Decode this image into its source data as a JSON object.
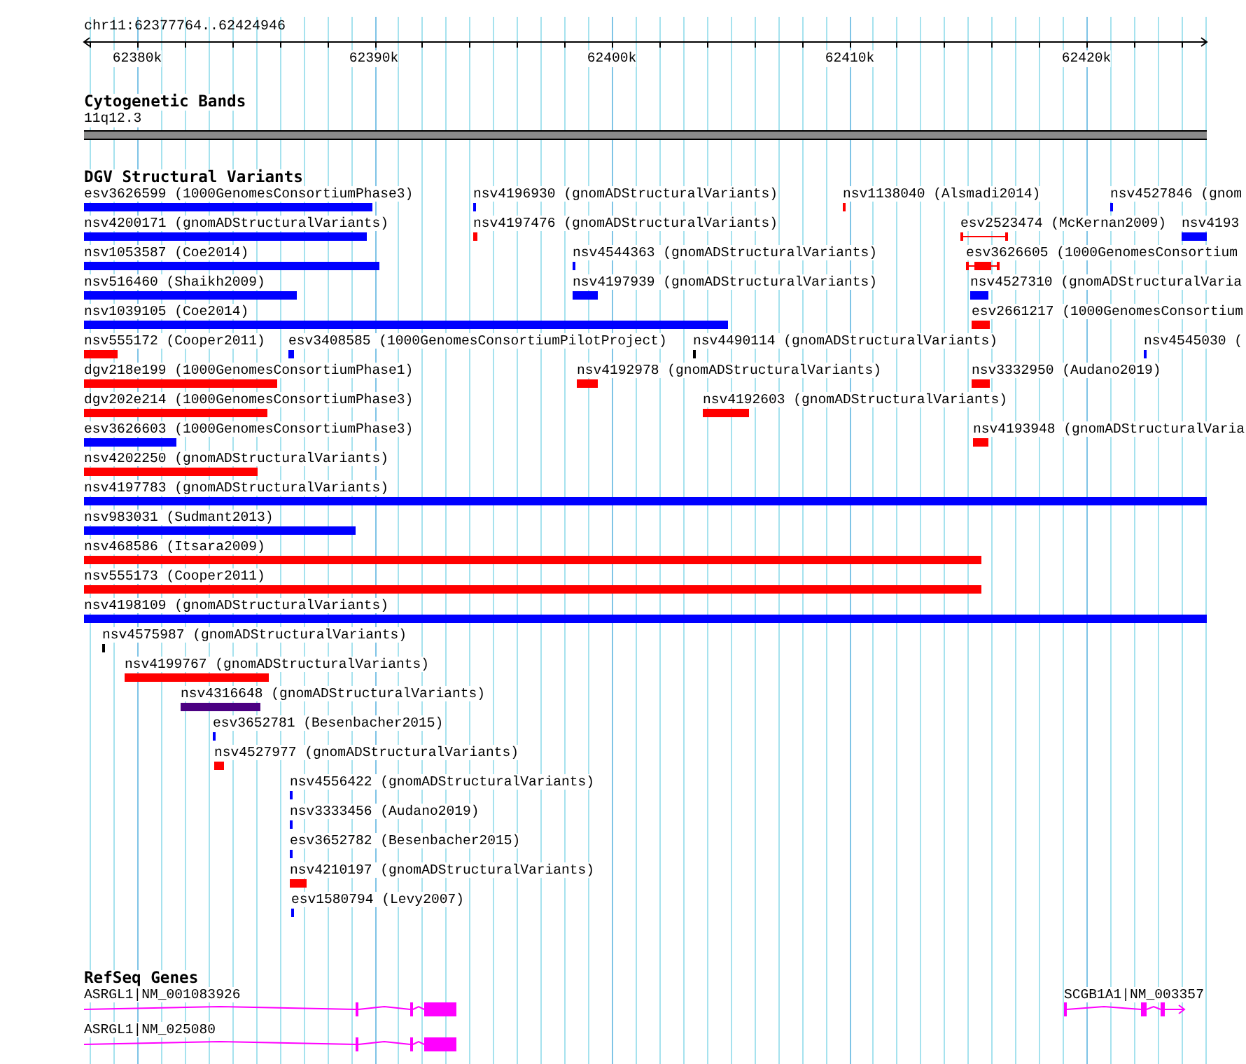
{
  "position": "chr11:62377764..62424946",
  "ruler": {
    "ticks": [
      {
        "label": "62380k"
      },
      {
        "label": "62390k"
      },
      {
        "label": "62400k"
      },
      {
        "label": "62410k"
      },
      {
        "label": "62420k"
      }
    ]
  },
  "cytoband": {
    "title": "Cytogenetic Bands",
    "band": "11q12.3"
  },
  "variants": {
    "title": "DGV Structural Variants",
    "rows": [
      {
        "features": [
          {
            "kind": "bar",
            "label": "esv3626599 (1000GenomesConsortiumPhase3)",
            "color": "#0000ff"
          },
          {
            "kind": "bar",
            "label": "nsv4196930 (gnomADStructuralVariants)",
            "color": "#0000ff"
          },
          {
            "kind": "bar",
            "label": "nsv1138040 (Alsmadi2014)",
            "color": "#ff0000"
          },
          {
            "kind": "bar",
            "label": "nsv4527846 (gnom",
            "color": "#0000ff"
          }
        ]
      },
      {
        "features": [
          {
            "kind": "bar",
            "label": "nsv4200171 (gnomADStructuralVariants)",
            "color": "#0000ff"
          },
          {
            "kind": "bar",
            "label": "nsv4197476 (gnomADStructuralVariants)",
            "color": "#ff0000"
          },
          {
            "kind": "interval",
            "label": "esv2523474 (McKernan2009)",
            "color": "#ff0000"
          },
          {
            "kind": "bar",
            "label": "nsv4193",
            "color": "#0000ff"
          }
        ]
      },
      {
        "features": [
          {
            "kind": "bar",
            "label": "nsv1053587 (Coe2014)",
            "color": "#0000ff"
          },
          {
            "kind": "bar",
            "label": "nsv4544363 (gnomADStructuralVariants)",
            "color": "#0000ff"
          },
          {
            "kind": "interval_bar",
            "label": "esv3626605 (1000GenomesConsortium",
            "color": "#ff0000"
          }
        ]
      },
      {
        "features": [
          {
            "kind": "bar",
            "label": "nsv516460 (Shaikh2009)",
            "color": "#0000ff"
          },
          {
            "kind": "bar",
            "label": "nsv4197939 (gnomADStructuralVariants)",
            "color": "#0000ff"
          },
          {
            "kind": "bar",
            "label": "nsv4527310 (gnomADStructuralVaria",
            "color": "#0000ff"
          }
        ]
      },
      {
        "features": [
          {
            "kind": "bar",
            "label": "nsv1039105 (Coe2014)",
            "color": "#0000ff"
          },
          {
            "kind": "bar",
            "label": "esv2661217 (1000GenomesConsortium",
            "color": "#ff0000"
          }
        ]
      },
      {
        "features": [
          {
            "kind": "bar",
            "label": "nsv555172 (Cooper2011)",
            "color": "#ff0000"
          },
          {
            "kind": "bar",
            "label": "esv3408585 (1000GenomesConsortiumPilotProject)",
            "color": "#0000ff"
          },
          {
            "kind": "bar",
            "label": "nsv4490114 (gnomADStructuralVariants)",
            "color": "#000000"
          },
          {
            "kind": "bar",
            "label": "nsv4545030 (",
            "color": "#0000ff"
          }
        ]
      },
      {
        "features": [
          {
            "kind": "bar",
            "label": "dgv218e199 (1000GenomesConsortiumPhase1)",
            "color": "#ff0000"
          },
          {
            "kind": "bar",
            "label": "nsv4192978 (gnomADStructuralVariants)",
            "color": "#ff0000"
          },
          {
            "kind": "bar",
            "label": "nsv3332950 (Audano2019)",
            "color": "#ff0000"
          }
        ]
      },
      {
        "features": [
          {
            "kind": "bar",
            "label": "dgv202e214 (1000GenomesConsortiumPhase3)",
            "color": "#ff0000"
          },
          {
            "kind": "bar",
            "label": "nsv4192603 (gnomADStructuralVariants)",
            "color": "#ff0000"
          }
        ]
      },
      {
        "features": [
          {
            "kind": "bar",
            "label": "esv3626603 (1000GenomesConsortiumPhase3)",
            "color": "#0000ff"
          },
          {
            "kind": "bar",
            "label": "nsv4193948 (gnomADStructuralVaria",
            "color": "#ff0000"
          }
        ]
      },
      {
        "features": [
          {
            "kind": "bar",
            "label": "nsv4202250 (gnomADStructuralVariants)",
            "color": "#ff0000"
          }
        ]
      },
      {
        "features": [
          {
            "kind": "bar",
            "label": "nsv4197783 (gnomADStructuralVariants)",
            "color": "#0000ff"
          }
        ]
      },
      {
        "features": [
          {
            "kind": "bar",
            "label": "nsv983031 (Sudmant2013)",
            "color": "#0000ff"
          }
        ]
      },
      {
        "features": [
          {
            "kind": "bar",
            "label": "nsv468586 (Itsara2009)",
            "color": "#ff0000"
          }
        ]
      },
      {
        "features": [
          {
            "kind": "bar",
            "label": "nsv555173 (Cooper2011)",
            "color": "#ff0000"
          }
        ]
      },
      {
        "features": [
          {
            "kind": "bar",
            "label": "nsv4198109 (gnomADStructuralVariants)",
            "color": "#0000ff"
          }
        ]
      },
      {
        "features": [
          {
            "kind": "bar",
            "label": "nsv4575987 (gnomADStructuralVariants)",
            "color": "#000000"
          }
        ]
      },
      {
        "features": [
          {
            "kind": "bar",
            "label": "nsv4199767 (gnomADStructuralVariants)",
            "color": "#ff0000"
          }
        ]
      },
      {
        "features": [
          {
            "kind": "bar",
            "label": "nsv4316648 (gnomADStructuralVariants)",
            "color": "#4b0082"
          }
        ]
      },
      {
        "features": [
          {
            "kind": "bar",
            "label": "esv3652781 (Besenbacher2015)",
            "color": "#0000ff"
          }
        ]
      },
      {
        "features": [
          {
            "kind": "bar",
            "label": "nsv4527977 (gnomADStructuralVariants)",
            "color": "#ff0000"
          }
        ]
      },
      {
        "features": [
          {
            "kind": "bar",
            "label": "nsv4556422 (gnomADStructuralVariants)",
            "color": "#0000ff"
          }
        ]
      },
      {
        "features": [
          {
            "kind": "bar",
            "label": "nsv3333456 (Audano2019)",
            "color": "#0000ff"
          }
        ]
      },
      {
        "features": [
          {
            "kind": "bar",
            "label": "esv3652782 (Besenbacher2015)",
            "color": "#0000ff"
          }
        ]
      },
      {
        "features": [
          {
            "kind": "bar",
            "label": "nsv4210197 (gnomADStructuralVariants)",
            "color": "#ff0000"
          }
        ]
      },
      {
        "features": [
          {
            "kind": "bar",
            "label": "esv1580794 (Levy2007)",
            "color": "#0000ff"
          }
        ]
      }
    ]
  },
  "genes": {
    "title": "RefSeq Genes",
    "rows": [
      {
        "features": [
          {
            "label": "ASRGL1|NM_001083926",
            "arrow": false
          },
          {
            "label": "SCGB1A1|NM_003357",
            "arrow": true
          }
        ]
      },
      {
        "features": [
          {
            "label": "ASRGL1|NM_025080",
            "arrow": false
          }
        ]
      }
    ]
  }
}
